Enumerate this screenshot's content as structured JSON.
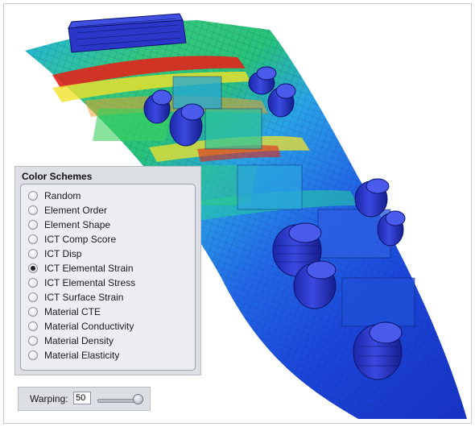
{
  "color_schemes": {
    "title": "Color Schemes",
    "selected": "ICT Elemental Strain",
    "options": [
      "Random",
      "Element Order",
      "Element Shape",
      "ICT Comp Score",
      "ICT Disp",
      "ICT Elemental Strain",
      "ICT Elemental Stress",
      "ICT Surface Strain",
      "Material CTE",
      "Material Conductivity",
      "Material Density",
      "Material Elasticity"
    ]
  },
  "warping": {
    "label": "Warping:",
    "value": "50",
    "slider_fraction": 1.0
  },
  "colors": {
    "strain_low": "#1a3fd6",
    "strain_mid_low": "#1fa0e8",
    "strain_mid": "#2fd07a",
    "strain_mid_high": "#f3e22b",
    "strain_high": "#e1251b",
    "component": "#2a37c8"
  }
}
